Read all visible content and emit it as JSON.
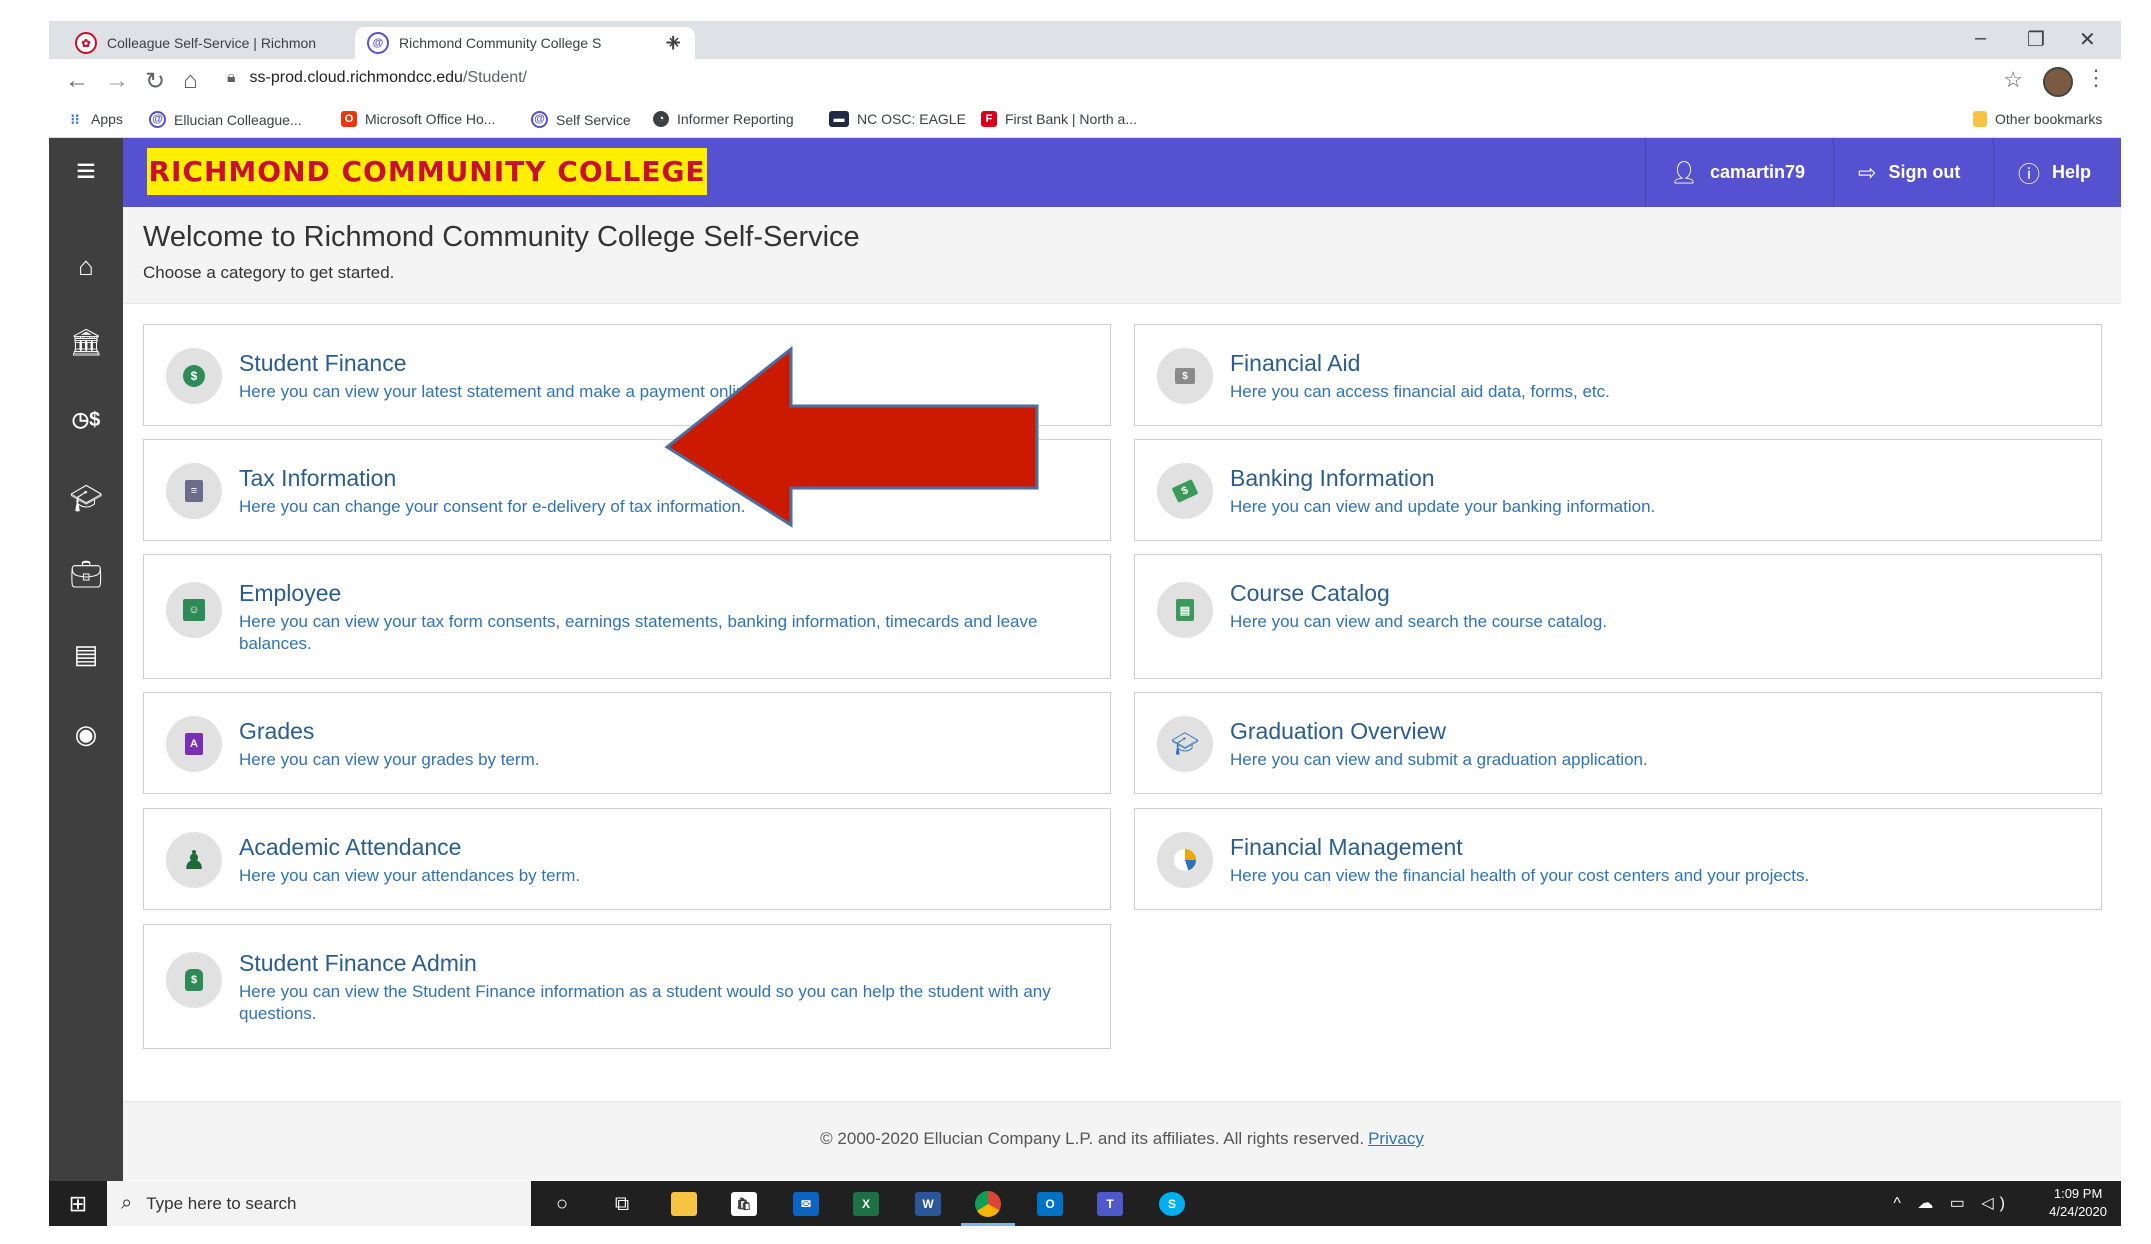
{
  "browser": {
    "tabs": [
      {
        "title": "Colleague Self-Service | Richmon",
        "active": false
      },
      {
        "title": "Richmond Community College S",
        "active": true
      }
    ],
    "new_tab_label": "+",
    "url_host": "ss-prod.cloud.richmondcc.edu",
    "url_path": "/Student/",
    "bookmarks": [
      {
        "label": "Apps",
        "icon": "apps-grid-icon"
      },
      {
        "label": "Ellucian Colleague...",
        "icon": "ellucian-icon"
      },
      {
        "label": "Microsoft Office Ho...",
        "icon": "office-icon"
      },
      {
        "label": "Self Service",
        "icon": "ellucian-icon"
      },
      {
        "label": "Informer Reporting",
        "icon": "informer-icon"
      },
      {
        "label": "NC OSC: EAGLE",
        "icon": "eagle-icon"
      },
      {
        "label": "First Bank | North a...",
        "icon": "first-bank-icon"
      }
    ],
    "other_bookmarks": "Other bookmarks"
  },
  "header": {
    "college_name": "RICHMOND COMMUNITY COLLEGE",
    "username": "camartin79",
    "sign_out": "Sign out",
    "help": "Help"
  },
  "welcome": {
    "title": "Welcome to Richmond Community College Self-Service",
    "subtitle": "Choose a category to get started."
  },
  "tiles": [
    {
      "title": "Student Finance",
      "desc": "Here you can view your latest statement and make a payment online.",
      "icon": "dollar-coin-icon"
    },
    {
      "title": "Financial Aid",
      "desc": "Here you can access financial aid data, forms, etc.",
      "icon": "dollar-bill-icon"
    },
    {
      "title": "Tax Information",
      "desc": "Here you can change your consent for e-delivery of tax information.",
      "icon": "tax-document-icon"
    },
    {
      "title": "Banking Information",
      "desc": "Here you can view and update your banking information.",
      "icon": "money-icon"
    },
    {
      "title": "Employee",
      "desc": "Here you can view your tax form consents, earnings statements, banking information, timecards and leave balances.",
      "icon": "employee-badge-icon"
    },
    {
      "title": "Course Catalog",
      "desc": "Here you can view and search the course catalog.",
      "icon": "catalog-book-icon"
    },
    {
      "title": "Grades",
      "desc": "Here you can view your grades by term.",
      "icon": "grade-a-icon"
    },
    {
      "title": "Graduation Overview",
      "desc": "Here you can view and submit a graduation application.",
      "icon": "graduation-cap-icon"
    },
    {
      "title": "Academic Attendance",
      "desc": "Here you can view your attendances by term.",
      "icon": "attendance-person-icon"
    },
    {
      "title": "Financial Management",
      "desc": "Here you can view the financial health of your cost centers and your projects.",
      "icon": "pie-chart-icon"
    },
    {
      "title": "Student Finance Admin",
      "desc": "Here you can view the Student Finance information as a student would so you can help the student with any questions.",
      "icon": "money-bag-icon"
    }
  ],
  "footer": {
    "copyright": "© 2000-2020 Ellucian Company L.P. and its affiliates. All rights reserved.",
    "privacy": "Privacy"
  },
  "taskbar": {
    "search_placeholder": "Type here to search",
    "time": "1:09 PM",
    "date": "4/24/2020"
  },
  "colors": {
    "header": "#5551d1",
    "sidebar": "#3f3f3f",
    "logo_bg": "#ffef00",
    "logo_text": "#c8102e",
    "link": "#2f73b6",
    "annotation_arrow": "#cc1a00"
  }
}
